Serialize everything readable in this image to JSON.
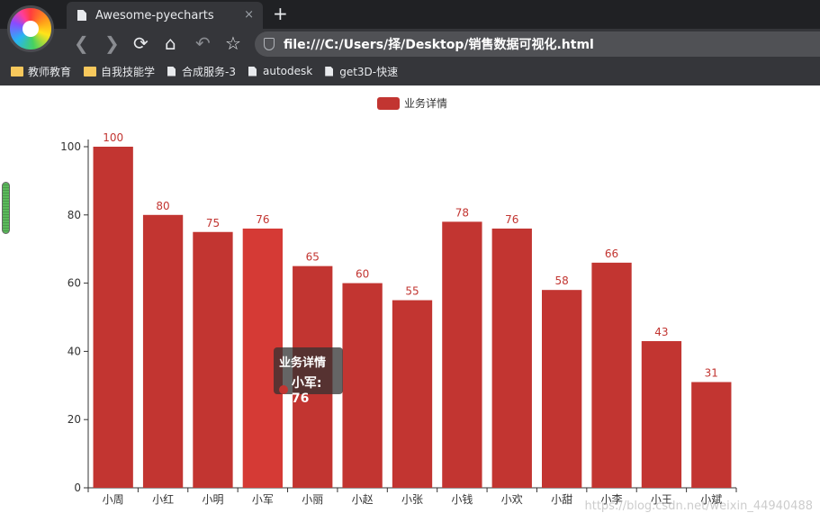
{
  "browser": {
    "tab_title": "Awesome-pyecharts",
    "tab_close": "×",
    "new_tab": "+",
    "url": "file:///C:/Users/择/Desktop/销售数据可视化.html",
    "bookmarks": [
      {
        "label": "教师教育",
        "icon": "folder-icon"
      },
      {
        "label": "自我技能学",
        "icon": "folder-icon"
      },
      {
        "label": "合成服务-3",
        "icon": "page-icon"
      },
      {
        "label": "autodesk",
        "icon": "page-icon"
      },
      {
        "label": "get3D-快速",
        "icon": "page-icon"
      }
    ]
  },
  "tooltip": {
    "title": "业务详情",
    "label": "小军: 76"
  },
  "watermark": "https://blog.csdn.net/weixin_44940488",
  "chart_data": {
    "type": "bar",
    "categories": [
      "小周",
      "小红",
      "小明",
      "小军",
      "小丽",
      "小赵",
      "小张",
      "小钱",
      "小欢",
      "小甜",
      "小李",
      "小王",
      "小斌"
    ],
    "series": [
      {
        "name": "业务详情",
        "values": [
          100,
          80,
          75,
          76,
          65,
          60,
          55,
          78,
          76,
          58,
          66,
          43,
          31
        ],
        "color": "#c23531",
        "highlight_color": "#d53a35"
      }
    ],
    "highlighted_category": "小军",
    "y_ticks": [
      "0",
      "20",
      "40",
      "60",
      "80",
      "100"
    ],
    "ylim": [
      0,
      100
    ],
    "legend_position": "top-center",
    "data_labels": true,
    "grid": false
  }
}
